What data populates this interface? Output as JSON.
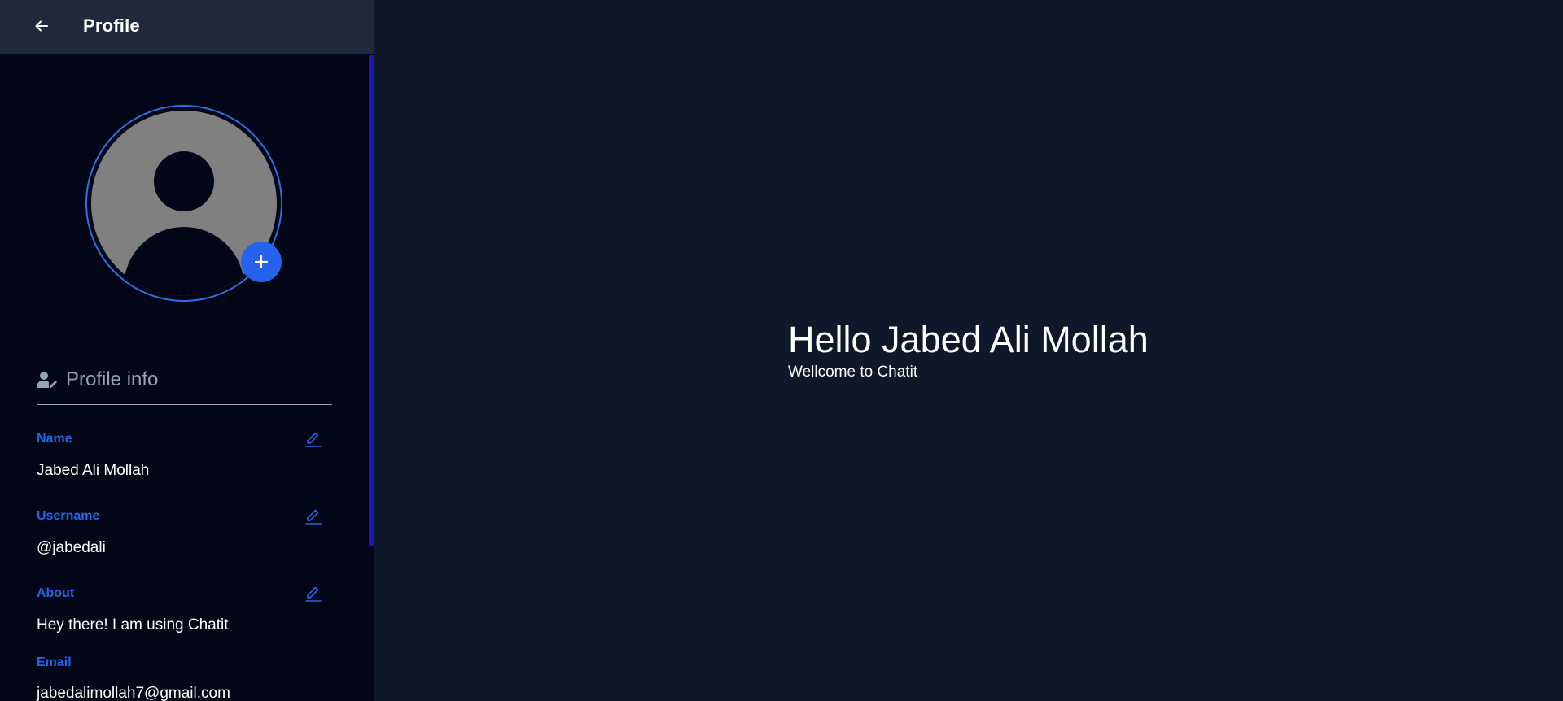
{
  "header": {
    "title": "Profile",
    "back_icon": "arrow-left-icon"
  },
  "avatar": {
    "icon": "user-placeholder-icon",
    "add_icon": "plus-icon"
  },
  "profile_info": {
    "title": "Profile info",
    "icon": "user-edit-icon",
    "fields": [
      {
        "label": "Name",
        "value": "Jabed Ali Mollah",
        "editable": true
      },
      {
        "label": "Username",
        "value": "@jabedali",
        "editable": true
      },
      {
        "label": "About",
        "value": "Hey there! I am using Chatit",
        "editable": true
      },
      {
        "label": "Email",
        "value": "jabedalimollah7@gmail.com",
        "editable": false
      }
    ]
  },
  "main": {
    "greeting": "Hello Jabed Ali Mollah",
    "subtitle": "Wellcome to Chatit"
  },
  "colors": {
    "accent": "#2563eb",
    "sidebar_bg": "#030616",
    "header_bg": "#1e293b",
    "main_bg": "#0f172a",
    "muted": "#94a3b8"
  }
}
